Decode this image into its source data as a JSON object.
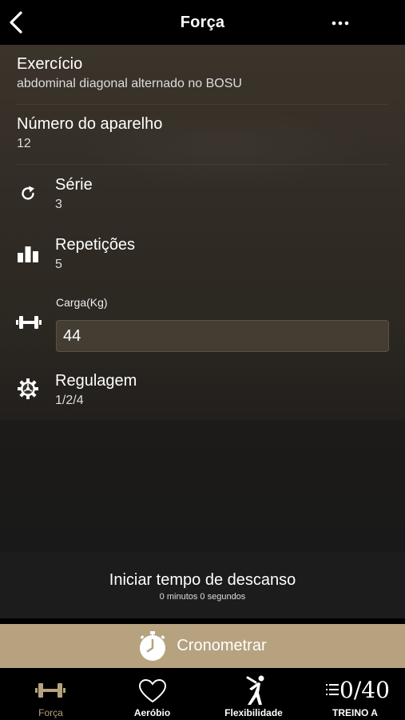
{
  "header": {
    "title": "Força"
  },
  "exercise": {
    "label": "Exercício",
    "value": "abdominal diagonal alternado no BOSU"
  },
  "device": {
    "label": "Número do aparelho",
    "value": "12"
  },
  "series": {
    "label": "Série",
    "value": "3"
  },
  "reps": {
    "label": "Repetições",
    "value": "5"
  },
  "load": {
    "label": "Carga(Kg)",
    "value": "44"
  },
  "adjust": {
    "label": "Regulagem",
    "value": "1/2/4"
  },
  "rest": {
    "title": "Iniciar tempo de descanso",
    "subtitle": "0 minutos 0 segundos"
  },
  "timer": {
    "label": "Cronometrar"
  },
  "tabs": {
    "forca": "Força",
    "aerobio": "Aeróbio",
    "flex": "Flexibilidade",
    "treino": "TREINO A",
    "progress": "0/40"
  },
  "colors": {
    "accent": "#b6a27f",
    "tab_active": "#b6a27f",
    "background": "#000000"
  }
}
